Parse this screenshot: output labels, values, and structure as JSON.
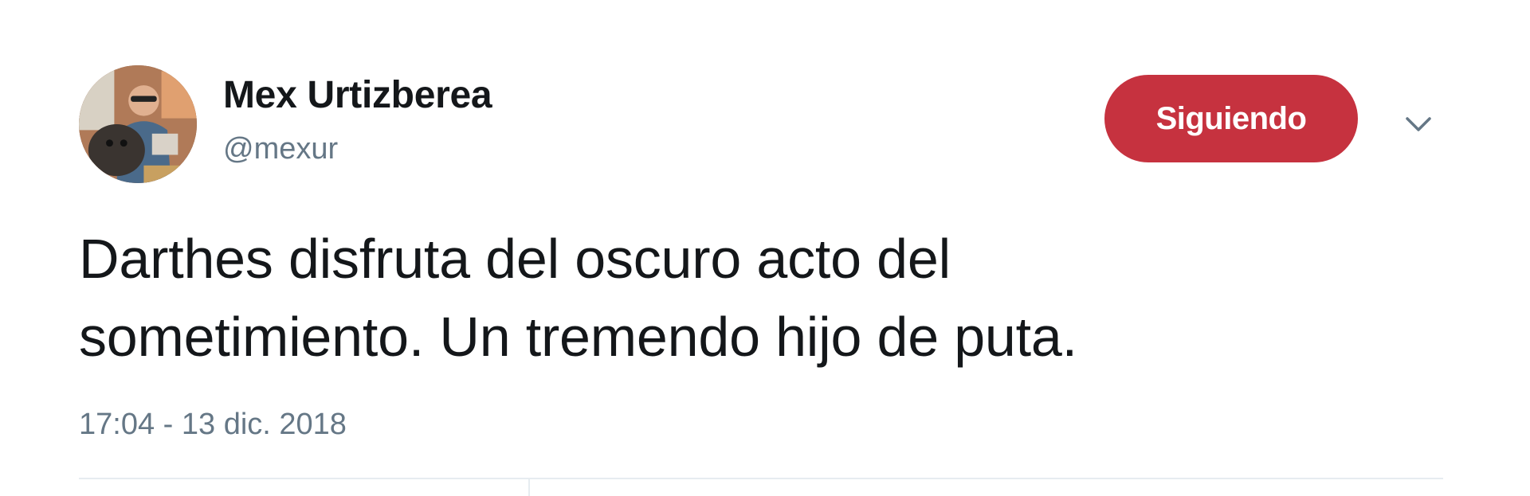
{
  "user": {
    "display_name": "Mex Urtizberea",
    "screen_name": "@mexur",
    "avatar_icon": "user-avatar-photo"
  },
  "follow_button": {
    "label": "Siguiendo",
    "color": "#c6323f"
  },
  "menu": {
    "caret_icon": "chevron-down-icon"
  },
  "tweet": {
    "text_lines": [
      "Darthes disfruta del oscuro acto del",
      "sometimiento. Un tremendo hijo de puta."
    ],
    "timestamp": "17:04 - 13 dic. 2018"
  }
}
